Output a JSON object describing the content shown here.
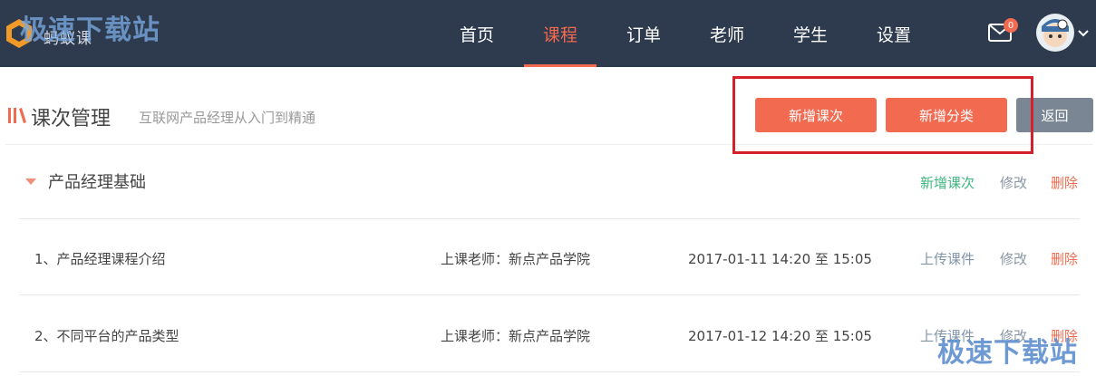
{
  "brand": {
    "logo_text": "蚂蚁课",
    "watermark": "极速下载站"
  },
  "nav": {
    "items": [
      {
        "label": "首页"
      },
      {
        "label": "课程"
      },
      {
        "label": "订单"
      },
      {
        "label": "老师"
      },
      {
        "label": "学生"
      },
      {
        "label": "设置"
      }
    ],
    "active_index": 1
  },
  "header_right": {
    "mail_badge": "0"
  },
  "page": {
    "title": "课次管理",
    "subtitle": "互联网产品经理从入门到精通",
    "buttons": {
      "add_lesson": "新增课次",
      "add_category": "新增分类",
      "back": "返回"
    }
  },
  "category": {
    "title": "产品经理基础",
    "actions": {
      "add_lesson": "新增课次",
      "edit": "修改",
      "delete": "删除"
    }
  },
  "lessons": [
    {
      "title": "1、产品经理课程介绍",
      "teacher": "上课老师：新点产品学院",
      "time": "2017-01-11 14:20 至 15:05",
      "upload": "上传课件",
      "edit": "修改",
      "delete": "删除"
    },
    {
      "title": "2、不同平台的产品类型",
      "teacher": "上课老师：新点产品学院",
      "time": "2017-01-12 14:20 至 15:05",
      "upload": "上传课件",
      "edit": "修改",
      "delete": "删除"
    }
  ],
  "colors": {
    "nav_bg": "#2e3a4d",
    "accent": "#f26a50",
    "green": "#3fb57e",
    "highlight_box": "#d3202b"
  },
  "icons": {
    "logo": "hexagon-logo-icon",
    "mail": "mail-icon",
    "caret": "chevron-down-icon",
    "title": "bars-icon",
    "expand": "triangle-down-icon"
  }
}
